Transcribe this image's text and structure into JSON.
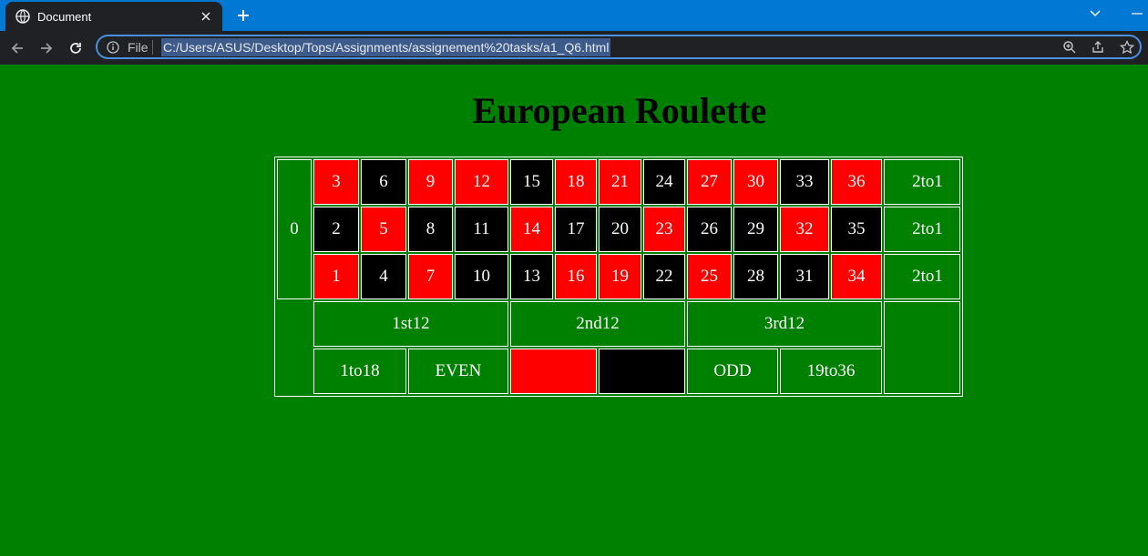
{
  "browser": {
    "tab_title": "Document",
    "address_scheme_label": "File",
    "url": "C:/Users/ASUS/Desktop/Tops/Assignments/assignement%20tasks/a1_Q6.html"
  },
  "page": {
    "title": "European Roulette"
  },
  "board": {
    "zero": "0",
    "rows": [
      [
        {
          "n": "3",
          "c": "red"
        },
        {
          "n": "6",
          "c": "black"
        },
        {
          "n": "9",
          "c": "red"
        },
        {
          "n": "12",
          "c": "red"
        },
        {
          "n": "15",
          "c": "black"
        },
        {
          "n": "18",
          "c": "red"
        },
        {
          "n": "21",
          "c": "red"
        },
        {
          "n": "24",
          "c": "black"
        },
        {
          "n": "27",
          "c": "red"
        },
        {
          "n": "30",
          "c": "red"
        },
        {
          "n": "33",
          "c": "black"
        },
        {
          "n": "36",
          "c": "red"
        }
      ],
      [
        {
          "n": "2",
          "c": "black"
        },
        {
          "n": "5",
          "c": "red"
        },
        {
          "n": "8",
          "c": "black"
        },
        {
          "n": "11",
          "c": "black"
        },
        {
          "n": "14",
          "c": "red"
        },
        {
          "n": "17",
          "c": "black"
        },
        {
          "n": "20",
          "c": "black"
        },
        {
          "n": "23",
          "c": "red"
        },
        {
          "n": "26",
          "c": "black"
        },
        {
          "n": "29",
          "c": "black"
        },
        {
          "n": "32",
          "c": "red"
        },
        {
          "n": "35",
          "c": "black"
        }
      ],
      [
        {
          "n": "1",
          "c": "red"
        },
        {
          "n": "4",
          "c": "black"
        },
        {
          "n": "7",
          "c": "red"
        },
        {
          "n": "10",
          "c": "black"
        },
        {
          "n": "13",
          "c": "black"
        },
        {
          "n": "16",
          "c": "red"
        },
        {
          "n": "19",
          "c": "red"
        },
        {
          "n": "22",
          "c": "black"
        },
        {
          "n": "25",
          "c": "red"
        },
        {
          "n": "28",
          "c": "black"
        },
        {
          "n": "31",
          "c": "black"
        },
        {
          "n": "34",
          "c": "red"
        }
      ]
    ],
    "column_bets": [
      "2to1",
      "2to1",
      "2to1"
    ],
    "dozens": [
      "1st12",
      "2nd12",
      "3rd12"
    ],
    "outside": {
      "low": "1to18",
      "even": "EVEN",
      "red": "",
      "black": "",
      "odd": "ODD",
      "high": "19to36"
    }
  },
  "colors": {
    "felt": "#008000",
    "red": "#ff0000",
    "black": "#000000",
    "tabstrip": "#0078d4",
    "toolbar": "#202124"
  }
}
